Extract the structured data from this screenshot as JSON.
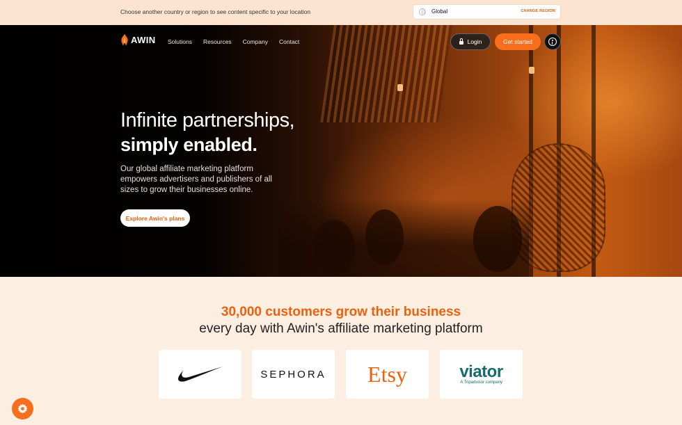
{
  "region_bar": {
    "message": "Choose another country or region to see content specific to your location",
    "selected": "Global",
    "change_label": "CHANGE REGION"
  },
  "header": {
    "logo_text": "AWIN",
    "nav": [
      "Solutions",
      "Resources",
      "Company",
      "Contact"
    ],
    "login_label": "Login",
    "get_started_label": "Get started"
  },
  "hero": {
    "title_line1": "Infinite partnerships,",
    "title_line2": "simply enabled.",
    "description": "Our global affiliate marketing platform empowers advertisers and publishers of all sizes to grow their businesses online.",
    "cta_label": "Explore Awin's plans"
  },
  "customers": {
    "title": "30,000 customers grow their business",
    "subtitle": "every day with Awin's affiliate marketing platform",
    "brands": [
      "Nike",
      "SEPHORA",
      "Etsy",
      "viator"
    ],
    "viator_tagline": "A Tripadvisor company"
  },
  "colors": {
    "brand_orange": "#f76f1c",
    "accent_text": "#e8620f",
    "page_bg": "#fdeee2",
    "viator_teal": "#186b6d"
  },
  "icons": [
    "globe-icon",
    "awin-flame-icon",
    "lock-icon",
    "accessibility-icon",
    "nike-swoosh-icon",
    "settings-gear-icon"
  ]
}
